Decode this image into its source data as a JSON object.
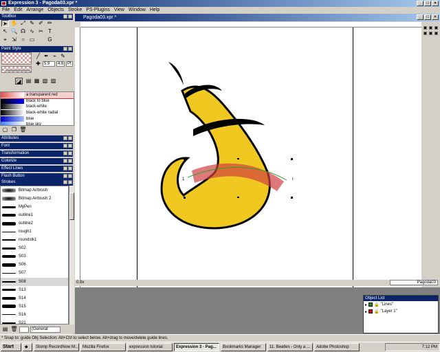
{
  "app": {
    "title": "Expression 3 - Pagoda03.xpr *",
    "menu": [
      "File",
      "Edit",
      "Arrange",
      "Objects",
      "Stroke",
      "PS-Plugins",
      "View",
      "Window",
      "Help"
    ]
  },
  "panels": {
    "toolbox": "ToolBox",
    "paint_style": "Paint Style",
    "attributes": "Attributes",
    "font": "Font",
    "transformation": "Transformation",
    "colorize": "Colorize",
    "effect_lines": "Effect Lines",
    "flash_button": "Flash Button",
    "strokes": "Strokes"
  },
  "paint_style": {
    "value1": "5.9",
    "value2": "4.6",
    "unit": "Pt"
  },
  "gradients": [
    {
      "label": "a transparent red",
      "c1": "#e05050",
      "c2": "#ffffff"
    },
    {
      "label": "black to blue",
      "c1": "#000000",
      "c2": "#0000ff"
    },
    {
      "label": "black-white",
      "c1": "#000000",
      "c2": "#ffffff"
    },
    {
      "label": "black-white radial",
      "c1": "#000000",
      "c2": "#ffffff"
    },
    {
      "label": "blue",
      "c1": "#0000c0",
      "c2": "#a0c0ff"
    },
    {
      "label": "blue sky",
      "c1": "#4080ff",
      "c2": "#ffffff"
    }
  ],
  "strokes": [
    "Bitmap Airbrush",
    "Bitmap Airbrush 2",
    "MyPen",
    "outline1",
    "outline2",
    "rough1",
    "roundstk1",
    "S02",
    "S03",
    "S06",
    "S07",
    "S08",
    "S13",
    "S14",
    "S15",
    "S16",
    "S21"
  ],
  "strokes_filter": "(Generat",
  "document": {
    "title": "Pagoda03.xpr *",
    "zoom": "0.8x",
    "page": "Pagoda03"
  },
  "object_list": {
    "title": "Object List",
    "layers": [
      {
        "name": "\"Lines\"",
        "color": "#00a000"
      },
      {
        "name": "\"Layer 1\"",
        "color": "#e00000"
      }
    ]
  },
  "status": "* Snap to: guide   Obj Selection: Alt+Ctrl to select below. Alt+drag to move/delete guide lines.",
  "taskbar": {
    "start": "Start",
    "tasks": [
      "Stomp RecordNow M...",
      "Mozilla Firefox",
      "expression tutorial",
      "Expression 3 - Pag...",
      "Bookmarks Manager",
      "11. Beatles - Only a ...",
      "Adobe Photoshop"
    ],
    "active_index": 3,
    "clock": "7:12 PM"
  },
  "colors": {
    "shape_fill": "#f0c820",
    "outline": "#000000",
    "accent_stroke": "#d04040",
    "title_blue": "#0a246a"
  }
}
